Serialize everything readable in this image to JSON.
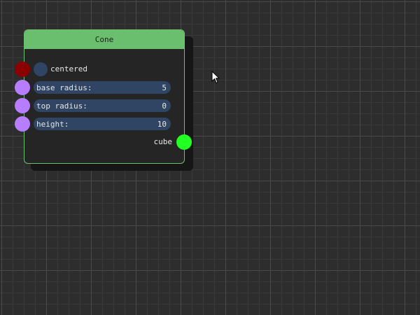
{
  "node": {
    "title": "Cone",
    "header_color": "#69bf6d",
    "border_color": "#6cc070",
    "body_color": "#252525",
    "inputs": [
      {
        "name": "centered",
        "type": "toggle",
        "socket_color": "#8b0000"
      },
      {
        "name": "base radius:",
        "value": "5",
        "socket_color": "#b77dff"
      },
      {
        "name": "top radius:",
        "value": "0",
        "socket_color": "#b77dff"
      },
      {
        "name": "height:",
        "value": "10",
        "socket_color": "#b77dff"
      }
    ],
    "output": {
      "name": "cube",
      "socket_color": "#22ff22"
    }
  },
  "canvas": {
    "background_color": "#2d2d2d",
    "grid_major": true,
    "grid_minor": true
  },
  "cursor_icon": "arrow-cursor-icon"
}
